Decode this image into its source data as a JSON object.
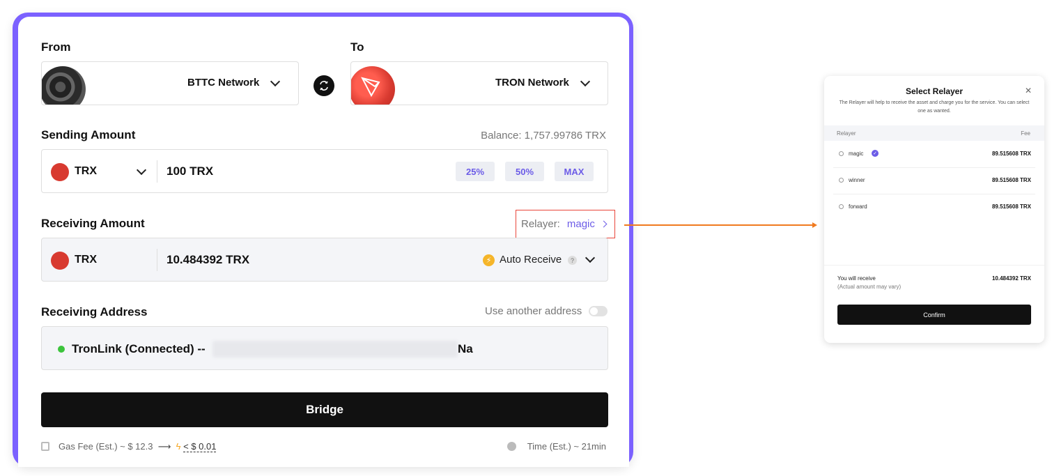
{
  "from": {
    "label": "From",
    "network": "BTTC Network"
  },
  "to": {
    "label": "To",
    "network": "TRON Network"
  },
  "sending": {
    "label": "Sending Amount",
    "balance": "Balance: 1,757.99786 TRX",
    "token": "TRX",
    "amount": "100 TRX",
    "presets": [
      "25%",
      "50%",
      "MAX"
    ]
  },
  "receiving": {
    "label": "Receiving Amount",
    "relayer_label": "Relayer:",
    "relayer_value": "magic",
    "token": "TRX",
    "amount": "10.484392 TRX",
    "auto_receive": "Auto Receive",
    "help": "?"
  },
  "address": {
    "label": "Receiving Address",
    "toggle_label": "Use another address",
    "wallet": "TronLink (Connected) --",
    "address_end": "Na"
  },
  "bridge_button": "Bridge",
  "footer": {
    "gas_fee": "Gas Fee (Est.) ~ $ 12.3",
    "gas_fee_discount": "< $ 0.01",
    "time": "Time (Est.) ~ 21min"
  },
  "modal": {
    "title": "Select Relayer",
    "description": "The Relayer will help to receive the asset and charge you for the service. You can select one as wanted.",
    "col_relayer": "Relayer",
    "col_fee": "Fee",
    "relayers": [
      {
        "name": "magic",
        "fee": "89.515608 TRX"
      },
      {
        "name": "winner",
        "fee": "89.515608 TRX"
      },
      {
        "name": "forward",
        "fee": "89.515608 TRX"
      }
    ],
    "receive_label": "You will receive",
    "receive_sub": "(Actual amount may vary)",
    "receive_value": "10.484392 TRX",
    "confirm": "Confirm"
  },
  "colors": {
    "accent": "#7b61ff",
    "link": "#6c5ce7",
    "highlight": "#e9453a",
    "arrow": "#f07a1f",
    "tron": "#d83a30"
  }
}
